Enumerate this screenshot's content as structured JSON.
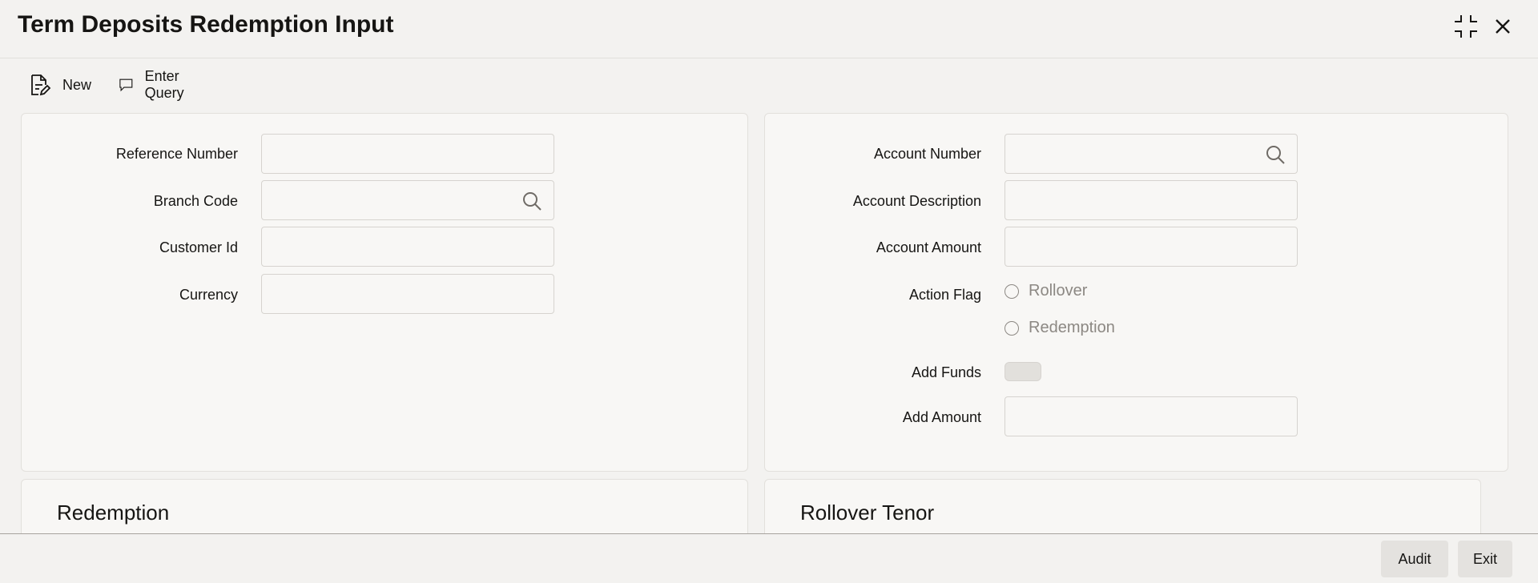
{
  "window": {
    "title": "Term Deposits Redemption Input",
    "collapse_icon": "collapse-icon",
    "close_icon": "close-icon"
  },
  "toolbar": {
    "new_label": "New",
    "enter_query_label": "Enter Query"
  },
  "left_panel": {
    "reference_number_label": "Reference Number",
    "reference_number_value": "",
    "branch_code_label": "Branch Code",
    "branch_code_value": "",
    "customer_id_label": "Customer Id",
    "customer_id_value": "",
    "currency_label": "Currency",
    "currency_value": ""
  },
  "right_panel": {
    "account_number_label": "Account Number",
    "account_number_value": "",
    "account_description_label": "Account Description",
    "account_description_value": "",
    "account_amount_label": "Account Amount",
    "account_amount_value": "",
    "action_flag_label": "Action Flag",
    "action_flag_options": [
      "Rollover",
      "Redemption"
    ],
    "add_funds_label": "Add Funds",
    "add_funds_on": false,
    "add_amount_label": "Add Amount",
    "add_amount_value": ""
  },
  "sections": {
    "redemption_title": "Redemption",
    "rollover_tenor_title": "Rollover Tenor"
  },
  "footer": {
    "audit_label": "Audit",
    "exit_label": "Exit"
  }
}
